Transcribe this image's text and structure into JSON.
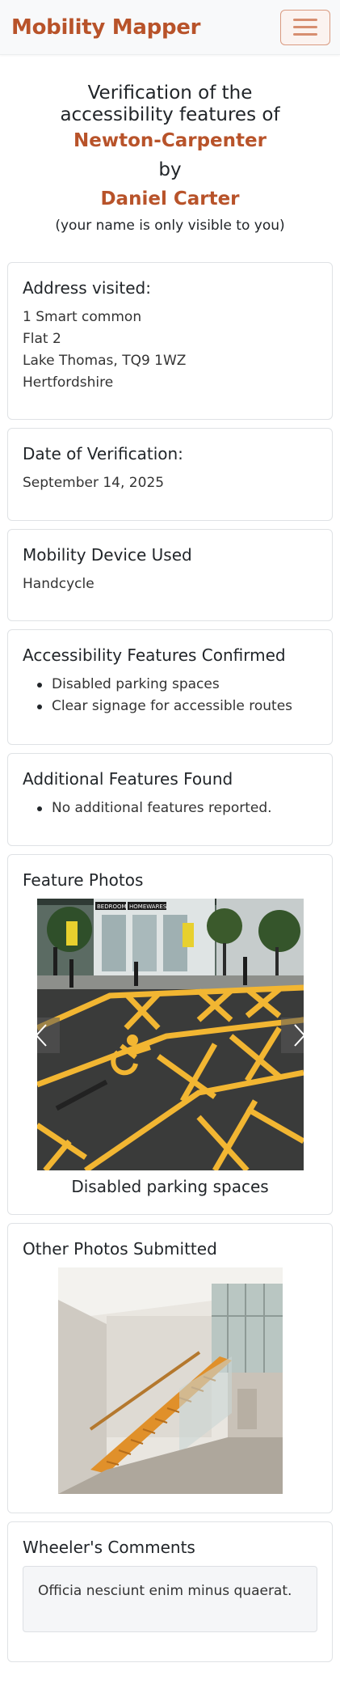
{
  "navbar": {
    "brand": "Mobility Mapper",
    "menu_icon": "hamburger-menu-icon"
  },
  "hero": {
    "line1": "Verification of the accessibility features of",
    "venue": "Newton-Carpenter",
    "by": "by",
    "user": "Daniel Carter",
    "note": "(your name is only visible to you)"
  },
  "address": {
    "title": "Address visited:",
    "lines": [
      "1 Smart common",
      "Flat 2",
      "Lake Thomas, TQ9 1WZ",
      "Hertfordshire"
    ]
  },
  "date": {
    "title": "Date of Verification:",
    "value": "September 14, 2025"
  },
  "device": {
    "title": "Mobility Device Used",
    "value": "Handcycle"
  },
  "confirmed": {
    "title": "Accessibility Features Confirmed",
    "items": [
      "Disabled parking spaces",
      "Clear signage for accessible routes"
    ]
  },
  "additional": {
    "title": "Additional Features Found",
    "items": [
      "No additional features reported."
    ]
  },
  "feature_photos": {
    "title": "Feature Photos",
    "caption": "Disabled parking spaces",
    "prev_icon": "chevron-left-icon",
    "next_icon": "chevron-right-icon",
    "sign_text_1": "BEDROOM",
    "sign_text_2": "HOMEWARES"
  },
  "other_photos": {
    "title": "Other Photos Submitted"
  },
  "comments": {
    "title": "Wheeler's Comments",
    "text": "Officia nesciunt enim minus quaerat."
  },
  "colors": {
    "brand": "#b8532a",
    "card_border": "#dfe2e5",
    "parking_line": "#f2b632"
  }
}
